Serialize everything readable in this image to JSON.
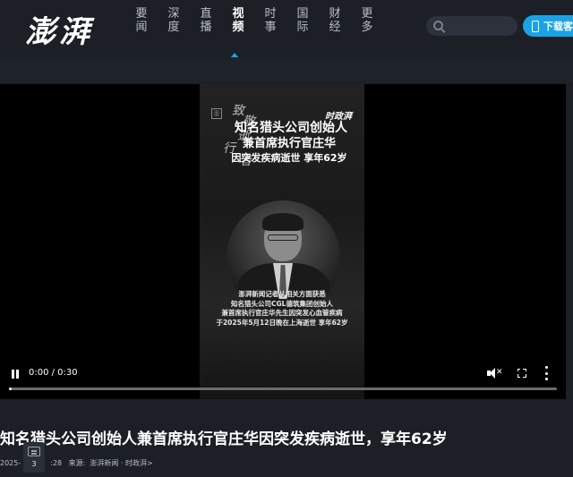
{
  "header": {
    "logo": "澎湃",
    "nav": [
      {
        "top": "要",
        "bottom": "闻",
        "active": false
      },
      {
        "top": "深",
        "bottom": "度",
        "active": false
      },
      {
        "top": "直",
        "bottom": "播",
        "active": false
      },
      {
        "top": "视",
        "bottom": "频",
        "active": true
      },
      {
        "top": "时",
        "bottom": "事",
        "active": false
      },
      {
        "top": "国",
        "bottom": "际",
        "active": false
      },
      {
        "top": "财",
        "bottom": "经",
        "active": false
      },
      {
        "top": "更",
        "bottom": "多",
        "active": false
      }
    ],
    "search": {
      "placeholder": ""
    },
    "download_label": "下载客户端",
    "accent_color": "#19a3e6"
  },
  "video": {
    "seal": "澎",
    "vertical_chars": [
      "致",
      "敬",
      "逝",
      "行",
      "者"
    ],
    "brand_tag": "时政湃",
    "title_lines": [
      "知名猎头公司创始人",
      "兼首席执行官庄华",
      "因突发疾病逝世 享年62岁"
    ],
    "caption_lines": [
      "澎湃新闻记者从相关方面获悉",
      "知名猎头公司CGL德筑集团创始人",
      "兼首席执行官庄华先生因突发心血管疾病",
      "于2025年5月12日晚在上海逝世 享年62岁"
    ]
  },
  "player": {
    "time": "0:00 / 0:30",
    "progress": 0.005,
    "muted": true
  },
  "article": {
    "title": "知名猎头公司创始人兼首席执行官庄华因突发疾病逝世，享年62岁",
    "date": "2025-",
    "time": ":28",
    "source_label": "来源:",
    "source": "澎湃新闻 · 时政湃>",
    "comment_count": "3"
  }
}
